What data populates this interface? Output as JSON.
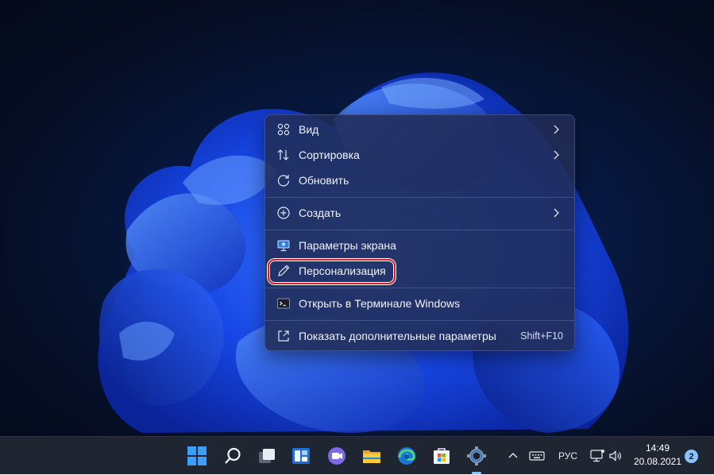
{
  "context_menu": {
    "items": [
      {
        "label": "Вид",
        "icon": "grid-icon",
        "submenu": true
      },
      {
        "label": "Сортировка",
        "icon": "sort-arrows-icon",
        "submenu": true
      },
      {
        "label": "Обновить",
        "icon": "refresh-icon",
        "submenu": false
      },
      {
        "label": "Создать",
        "icon": "plus-circle-icon",
        "submenu": true
      },
      {
        "label": "Параметры экрана",
        "icon": "display-icon",
        "submenu": false
      },
      {
        "label": "Персонализация",
        "icon": "pen-icon",
        "submenu": false,
        "highlighted": true
      },
      {
        "label": "Открыть в Терминале Windows",
        "icon": "terminal-icon",
        "submenu": false
      },
      {
        "label": "Показать дополнительные параметры",
        "icon": "more-options-icon",
        "shortcut": "Shift+F10"
      }
    ]
  },
  "taskbar": {
    "apps": [
      "start-icon",
      "search-icon",
      "task-view-icon",
      "widgets-icon",
      "teams-chat-icon",
      "file-explorer-icon",
      "edge-icon",
      "store-icon",
      "settings-icon"
    ],
    "tray": {
      "language": "РУС",
      "time": "14:49",
      "date": "20.08.2021",
      "notifications": "2"
    }
  },
  "colors": {
    "highlight_outline": "#d42028",
    "taskbar_bg": "#202532",
    "menu_bg": "#212c56"
  }
}
